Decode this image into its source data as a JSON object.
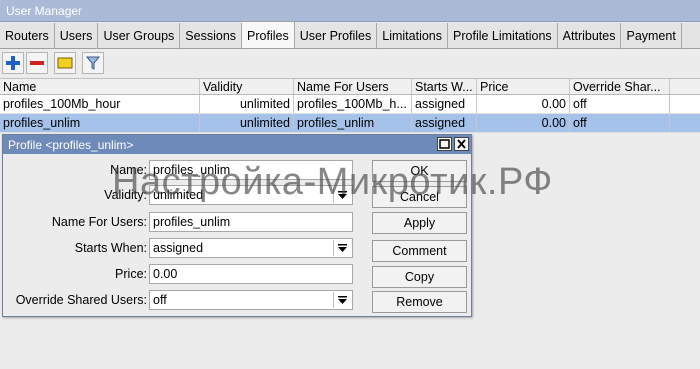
{
  "window": {
    "title": "User Manager"
  },
  "tabs": [
    "Routers",
    "Users",
    "User Groups",
    "Sessions",
    "Profiles",
    "User Profiles",
    "Limitations",
    "Profile Limitations",
    "Attributes",
    "Payment"
  ],
  "active_tab": "Profiles",
  "toolbar": {
    "buttons": [
      {
        "name": "add-icon",
        "color": "#1f5fc8"
      },
      {
        "name": "remove-icon",
        "color": "#d02020"
      },
      {
        "name": "comment-icon",
        "color": "#f0d020"
      },
      {
        "name": "filter-icon",
        "color": "#5080c0"
      }
    ]
  },
  "table": {
    "columns": [
      "Name",
      "Validity",
      "Name For Users",
      "Starts W...",
      "Price",
      "Override Shar..."
    ],
    "rows": [
      {
        "name": "profiles_100Mb_hour",
        "validity": "unlimited",
        "name_for_users": "profiles_100Mb_h...",
        "starts_when": "assigned",
        "price": "0.00",
        "override": "off"
      },
      {
        "name": "profiles_unlim",
        "validity": "unlimited",
        "name_for_users": "profiles_unlim",
        "starts_when": "assigned",
        "price": "0.00",
        "override": "off"
      }
    ]
  },
  "dialog": {
    "title": "Profile <profiles_unlim>",
    "fields": {
      "name": {
        "label": "Name:",
        "value": "profiles_unlim"
      },
      "validity": {
        "label": "Validity:",
        "value": "unlimited"
      },
      "name_for_users": {
        "label": "Name For Users:",
        "value": "profiles_unlim"
      },
      "starts_when": {
        "label": "Starts When:",
        "value": "assigned"
      },
      "price": {
        "label": "Price:",
        "value": "0.00"
      },
      "override": {
        "label": "Override Shared Users:",
        "value": "off"
      }
    },
    "buttons": {
      "ok": "OK",
      "cancel": "Cancel",
      "apply": "Apply",
      "comment": "Comment",
      "copy": "Copy",
      "remove": "Remove"
    }
  },
  "watermark": "Настройка-Микротик.РФ"
}
